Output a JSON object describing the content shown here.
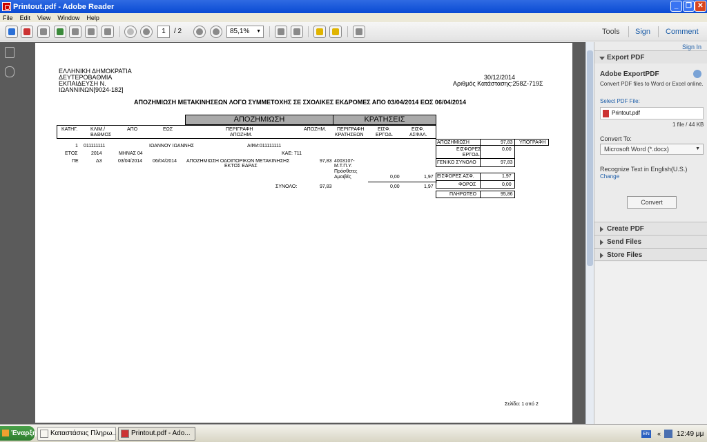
{
  "window": {
    "title": "Printout.pdf - Adobe Reader"
  },
  "menu": [
    "File",
    "Edit",
    "View",
    "Window",
    "Help"
  ],
  "toolbar": {
    "page_current": "1",
    "page_total": "/ 2",
    "zoom": "85,1%",
    "tabs": [
      "Tools",
      "Sign",
      "Comment"
    ]
  },
  "doc": {
    "org": [
      "ΕΛΛΗΝΙΚΗ ΔΗΜΟΚΡΑΤΙΑ",
      "ΔΕΥΤΕΡΟΒΑΘΜΙΑ",
      "ΕΚΠΑΙΔΕΥΣΗ Ν.",
      "ΙΩΑΝΝΙΝΩΝ[9024-182]"
    ],
    "date": "30/12/2014",
    "ref": "Αριθμός Κατάστασης:258Ζ-719Σ",
    "title": "ΑΠΟΖΗΜΙΩΣΗ ΜΕΤΑΚΙΝΗΣΕΩΝ ΛΟΓΩ ΣΥΜΜΕΤΟΧΗΣ ΣΕ ΣΧΟΛΙΚΕΣ ΕΚΔΡΟΜΕΣ ΑΠΟ 03/04/2014 ΕΩΣ 06/04/2014",
    "group1": "ΑΠΟΖΗΜΙΩΣΗ",
    "group2": "ΚΡΑΤΗΣΕΙΣ",
    "cols": {
      "kat": "ΚΑΤΗΓ.",
      "klim": "ΚΛΙΜ./",
      "vathmos": "ΒΑΘΜΟΣ",
      "apo": "ΑΠΟ",
      "eos": "ΕΩΣ",
      "perigrafi": "ΠΕΡΙΓΡΑΦΗ",
      "apozim_short": "ΑΠΟΖΗΜ.",
      "apozim": "ΑΠΟΖΗΜ.",
      "perigrafi2": "ΠΕΡΙΓΡΑΦΗ",
      "kratiseon": "ΚΡΑΤΗΣΕΩΝ",
      "eisf1": "ΕΙΣΦ.",
      "ergod": "ΕΡΓΟΔ.",
      "eisf2": "ΕΙΣΦ.",
      "asfal": "ΑΣΦΑΛ."
    },
    "row": {
      "num": "1",
      "id": "011111111",
      "name": "ΙΩΑΝΝΟΥ ΙΩΑΝΝΗΣ",
      "afm": "ΑΦΜ:011111111",
      "etos_l": "ΕΤΟΣ",
      "etos": "2014",
      "minas": "ΜΗΝΑΣ 04",
      "kae": "ΚΑΕ: 711",
      "kat": "ΠΕ",
      "vathmos": "Δ3",
      "apo": "03/04/2014",
      "eos": "06/04/2014",
      "desc1": "ΑΠΟΖΗΜΙΩΣΗ ΟΔΟΙΠΟΡΙΚΩΝ ΜΕΤΑΚΙΝΗΣΗΣ",
      "desc2": "ΕΚΤΟΣ ΕΔΡΑΣ",
      "amount": "97,83",
      "krat1": "4003107-",
      "krat2": "Μ.Τ.Π.Υ.",
      "krat3": "Πρόσθετες",
      "krat4": "Αμοιβές",
      "ergod": "0,00",
      "asfal": "1,97"
    },
    "synolo_l": "ΣΥΝΟΛΟ:",
    "synolo": "97,83",
    "synolo_ergod": "0,00",
    "synolo_asfal": "1,97",
    "summary": [
      {
        "label": "ΑΠΟΖΗΜΙΩΣΗ",
        "value": "97,83"
      },
      {
        "label": "ΕΙΣΦΟΡΕΣ ΕΡΓΟΔ.",
        "value": "0,00"
      },
      {
        "label": "ΓΕΝΙΚΟ ΣΥΝΟΛΟ",
        "value": "97,83"
      }
    ],
    "ypografi": "ΥΠΟΓΡΑΦΗ",
    "summary2": [
      {
        "label": "ΕΙΣΦΟΡΕΣ ΑΣΦ.",
        "value": "1,97"
      },
      {
        "label": "ΦΟΡΟΣ",
        "value": "0,00"
      }
    ],
    "pliroteo": {
      "label": "ΠΛΗΡΩΤΕΟ",
      "value": "95,86"
    },
    "footer": "Σελίδα: 1 από  2"
  },
  "panel": {
    "signin": "Sign In",
    "export_title": "Export PDF",
    "adobe": "Adobe ExportPDF",
    "desc": "Convert PDF files to Word or Excel online.",
    "select_label": "Select PDF File:",
    "file": "Printout.pdf",
    "filecount": "1 file / 44 KB",
    "convert_to": "Convert To:",
    "format": "Microsoft Word (*.docx)",
    "recognize": "Recognize Text in English(U.S.)",
    "change": "Change",
    "convert_btn": "Convert",
    "sections": [
      "Create PDF",
      "Send Files",
      "Store Files"
    ]
  },
  "taskbar": {
    "start": "Έναρξη",
    "items": [
      "Καταστάσεις Πληρω...",
      "Printout.pdf - Ado..."
    ],
    "lang": "EN",
    "clock": "12:49 μμ"
  }
}
